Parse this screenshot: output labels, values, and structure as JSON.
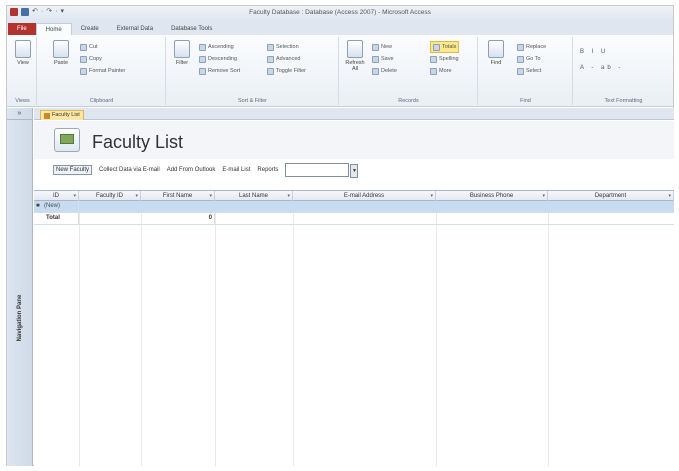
{
  "window": {
    "title": "Faculty Database : Database (Access 2007) - Microsoft Access",
    "qat_glyphs": [
      "↶",
      "·",
      "↷",
      "·",
      "▾"
    ]
  },
  "ribbon": {
    "tabs": [
      "File",
      "Home",
      "Create",
      "External Data",
      "Database Tools"
    ],
    "active_tab": "Home",
    "groups": {
      "views": {
        "label": "Views",
        "view_button": "View"
      },
      "clipboard": {
        "label": "Clipboard",
        "paste_button": "Paste",
        "cut": "Cut",
        "copy": "Copy",
        "format_painter": "Format Painter"
      },
      "sort_filter": {
        "label": "Sort & Filter",
        "filter_button": "Filter",
        "ascending": "Ascending",
        "descending": "Descending",
        "remove_sort": "Remove Sort",
        "selection": "Selection",
        "advanced": "Advanced",
        "toggle_filter": "Toggle Filter"
      },
      "records": {
        "label": "Records",
        "refresh_button": "Refresh All",
        "new": "New",
        "save": "Save",
        "delete": "Delete",
        "totals": "Totals",
        "spelling": "Spelling",
        "more": "More"
      },
      "find": {
        "label": "Find",
        "find_button": "Find",
        "replace": "Replace",
        "go_to": "Go To",
        "select": "Select"
      },
      "text_formatting": {
        "label": "Text Formatting",
        "glyphs_row1": "B I U",
        "glyphs_row2": "A - ab -"
      }
    }
  },
  "nav_pane": {
    "label": "Navigation Pane",
    "toggle_glyph": "»"
  },
  "document": {
    "tab_label": "Faculty List",
    "form_title": "Faculty List",
    "toolbar": {
      "new_faculty": "New Faculty",
      "collect_data": "Collect Data via E-mail",
      "add_from_outlook": "Add From Outlook",
      "email_list": "E-mail List",
      "reports_label": "Reports"
    },
    "columns": [
      "ID",
      "Faculty ID",
      "First Name",
      "Last Name",
      "E-mail Address",
      "Business Phone",
      "Department"
    ],
    "new_row_label": "(New)",
    "new_row_marker": "✱",
    "total_row": {
      "label": "Total",
      "value": "0"
    }
  }
}
